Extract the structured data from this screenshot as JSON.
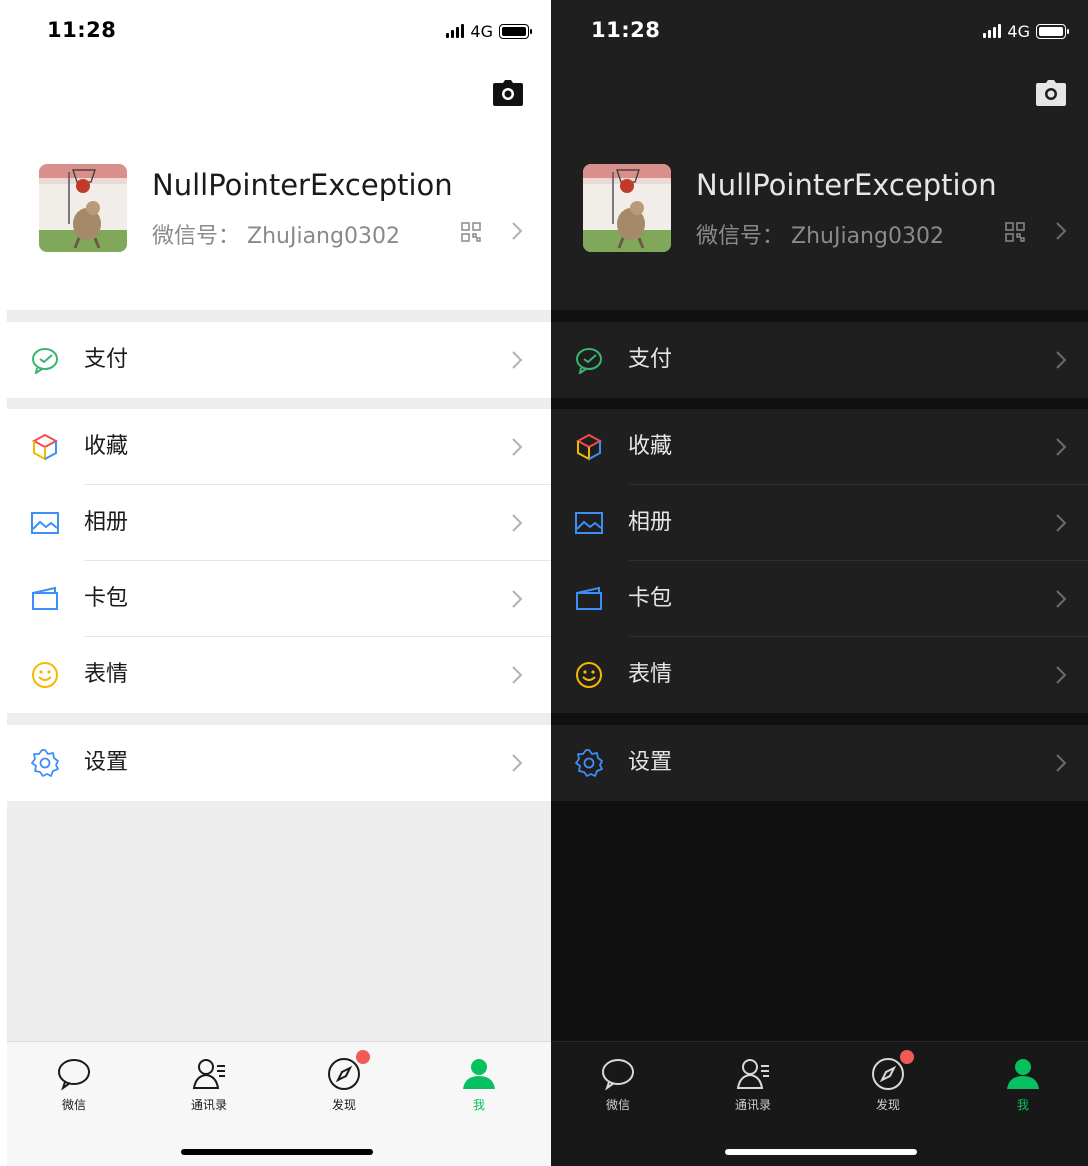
{
  "status": {
    "time": "11:28",
    "network": "4G"
  },
  "profile": {
    "nickname": "NullPointerException",
    "wechat_id_label": "微信号：",
    "wechat_id": "ZhuJiang0302"
  },
  "menu": {
    "pay": "支付",
    "favorites": "收藏",
    "album": "相册",
    "cards": "卡包",
    "stickers": "表情",
    "settings": "设置"
  },
  "tabs": [
    {
      "label": "微信"
    },
    {
      "label": "通讯录"
    },
    {
      "label": "发现"
    },
    {
      "label": "我"
    }
  ],
  "colors": {
    "accent_green": "#07c160",
    "badge_red": "#f25a55",
    "light_bg": "#ededed",
    "dark_bg": "#111111",
    "dark_cell": "#1f1f1f"
  },
  "icons": {
    "pay": "wechat-pay-icon",
    "favorites": "cube-icon",
    "album": "picture-icon",
    "cards": "card-wallet-icon",
    "stickers": "smiley-icon",
    "settings": "gear-icon",
    "camera": "camera-icon",
    "qr": "qr-code-icon"
  }
}
